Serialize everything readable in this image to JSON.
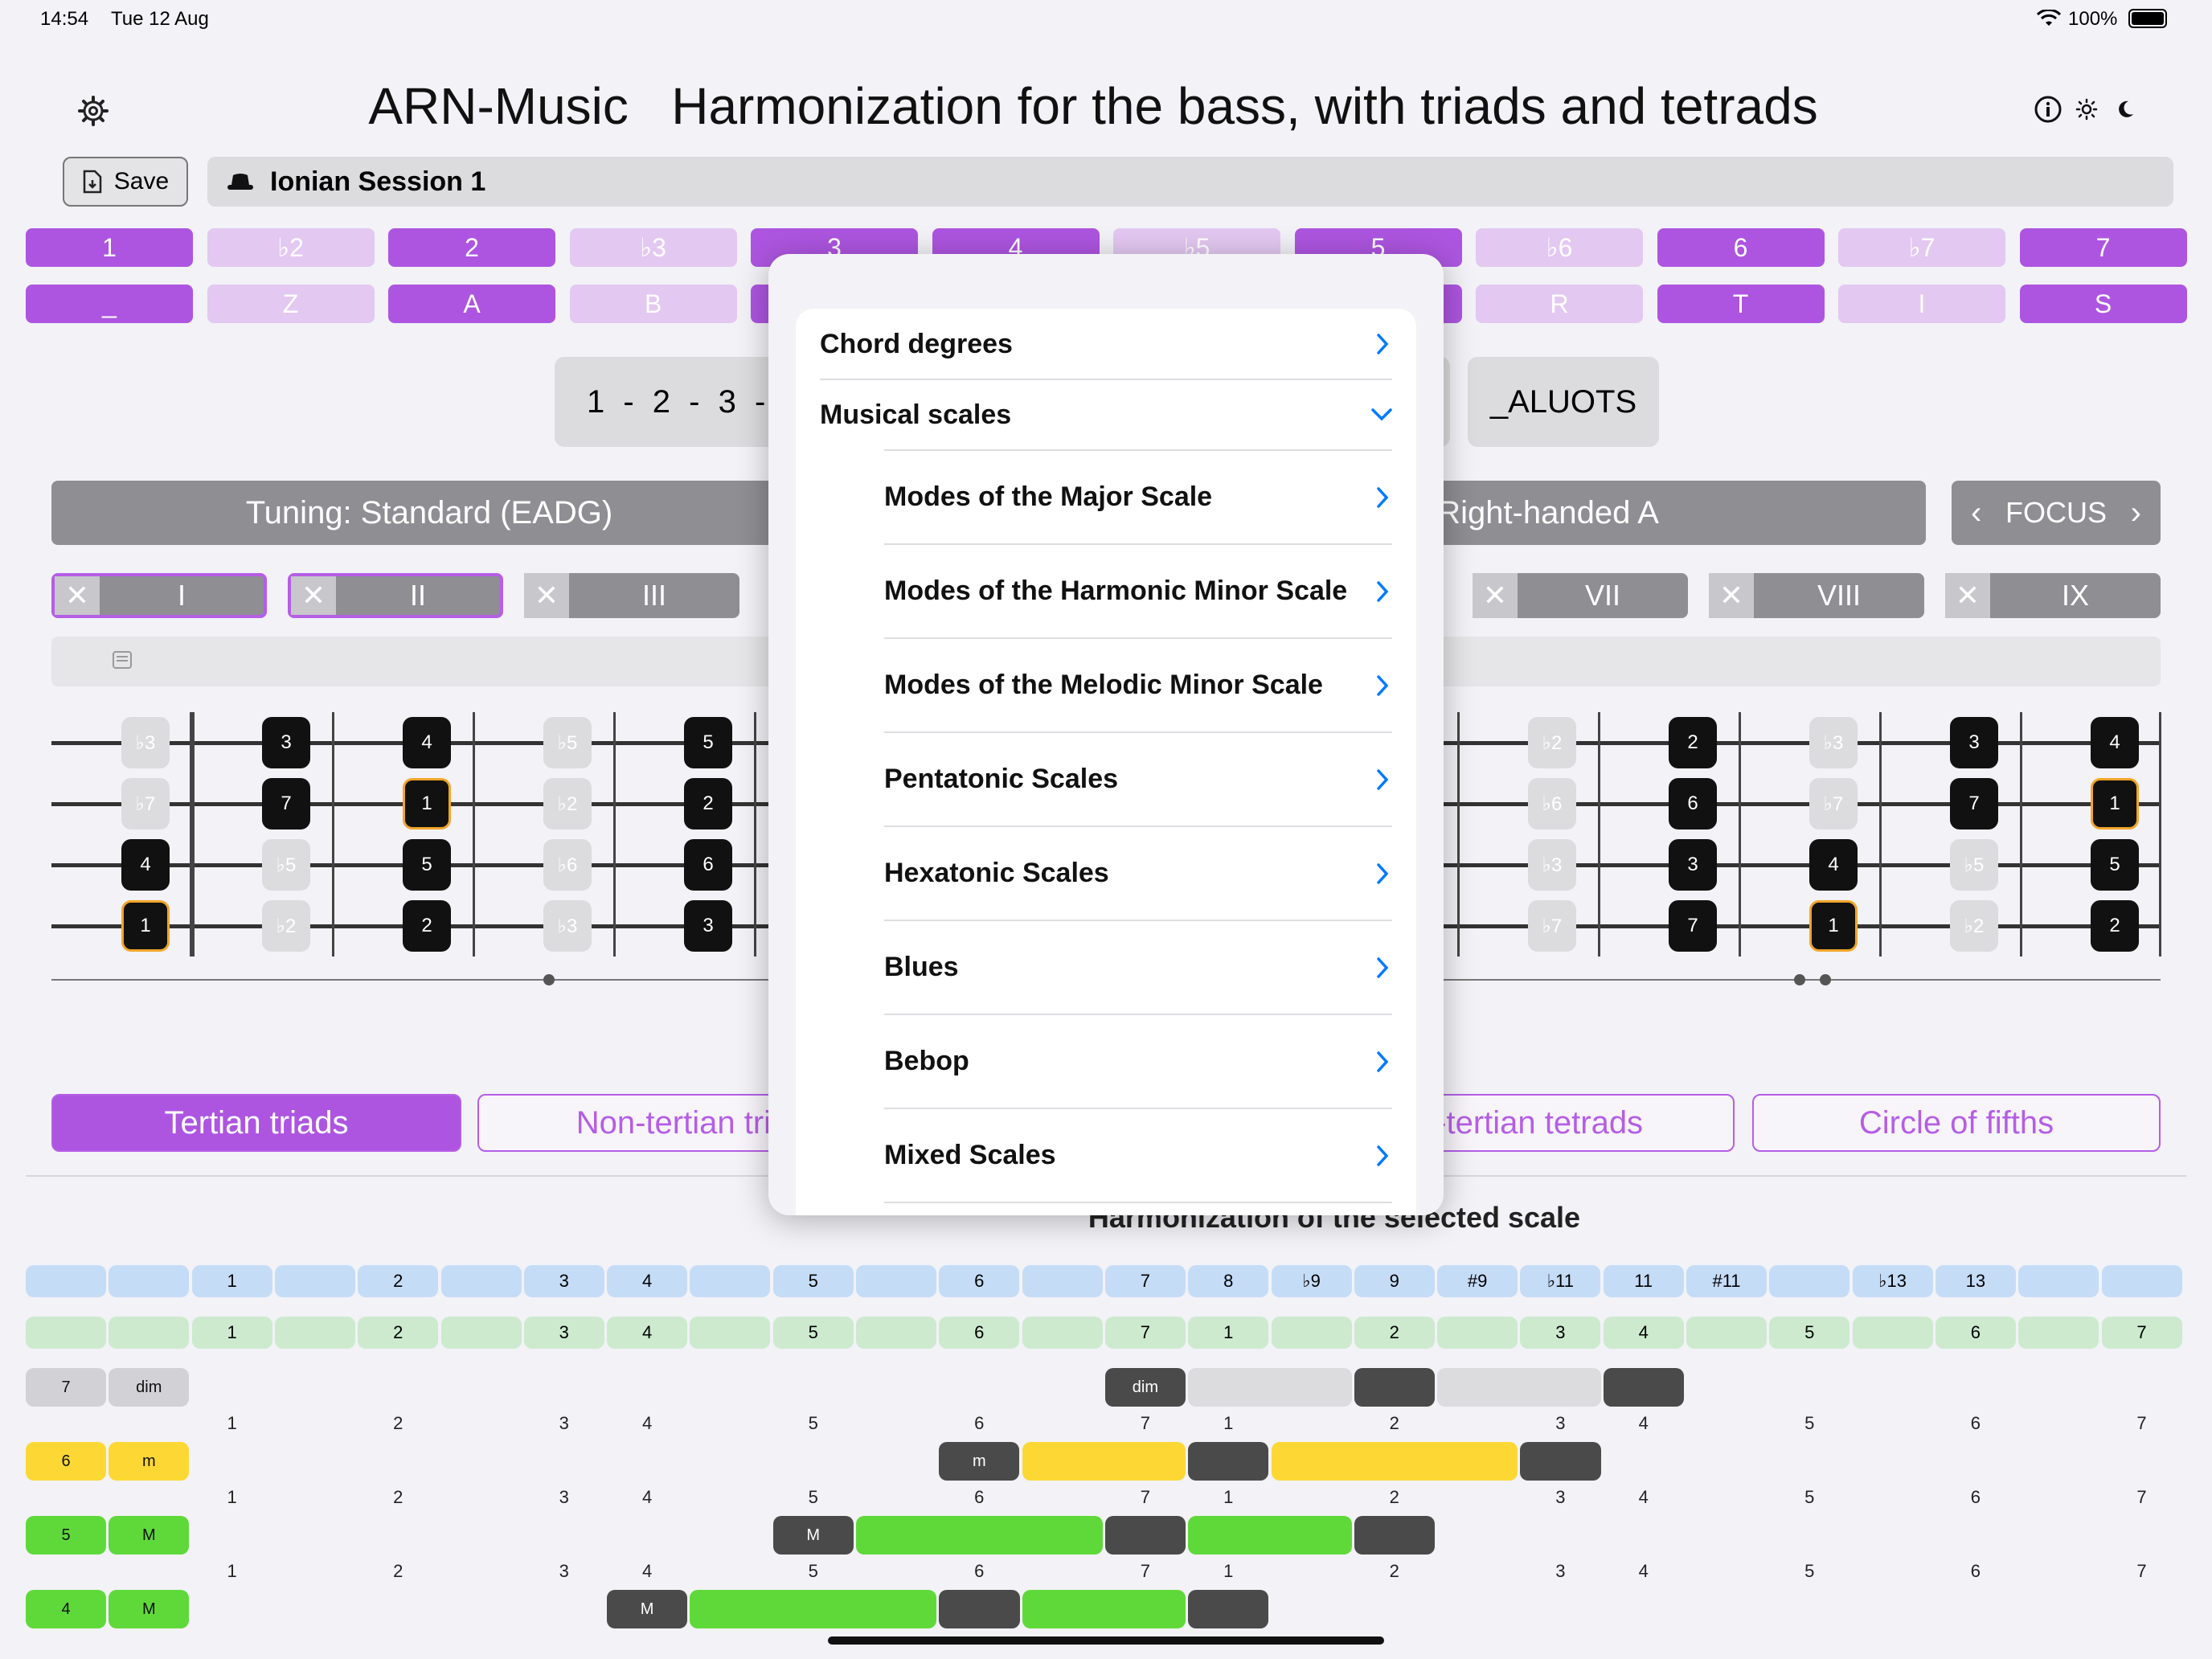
{
  "status": {
    "time": "14:54",
    "date": "Tue 12 Aug",
    "battery": "100%"
  },
  "header": {
    "title": "ARN-Music   Harmonization for the bass, with triads and tetrads"
  },
  "toolbar": {
    "save_label": "Save",
    "session_name": "Ionian Session 1"
  },
  "degrees_top": [
    "1",
    "♭2",
    "2",
    "♭3",
    "3",
    "4",
    "♭5",
    "5",
    "♭6",
    "6",
    "♭7",
    "7"
  ],
  "degrees_bottom": [
    "_",
    "Z",
    "A",
    "B",
    "",
    "",
    "",
    "",
    "R",
    "T",
    "I",
    "S"
  ],
  "degree_state": [
    true,
    false,
    true,
    false,
    true,
    true,
    false,
    true,
    false,
    true,
    false,
    true
  ],
  "sequence": {
    "text": "1 - 2 - 3 -",
    "letters": "_ALUOTS"
  },
  "tuning": {
    "label": "Tuning: Standard (EADG)",
    "hand": ": Right-handed A",
    "focus": "FOCUS"
  },
  "positions": [
    {
      "label": "I",
      "selected": true
    },
    {
      "label": "II",
      "selected": true
    },
    {
      "label": "III",
      "selected": false
    },
    {
      "label": "VII",
      "selected": false
    },
    {
      "label": "VIII",
      "selected": false
    },
    {
      "label": "IX",
      "selected": false
    }
  ],
  "fretboard": {
    "left": [
      {
        "col": 0,
        "row": 0,
        "t": "♭3",
        "k": "g"
      },
      {
        "col": 0,
        "row": 1,
        "t": "♭7",
        "k": "g"
      },
      {
        "col": 0,
        "row": 2,
        "t": "4",
        "k": "b"
      },
      {
        "col": 0,
        "row": 3,
        "t": "1",
        "k": "r"
      },
      {
        "col": 1,
        "row": 0,
        "t": "3",
        "k": "b"
      },
      {
        "col": 1,
        "row": 1,
        "t": "7",
        "k": "b"
      },
      {
        "col": 1,
        "row": 2,
        "t": "♭5",
        "k": "g"
      },
      {
        "col": 1,
        "row": 3,
        "t": "♭2",
        "k": "g"
      },
      {
        "col": 2,
        "row": 0,
        "t": "4",
        "k": "b"
      },
      {
        "col": 2,
        "row": 1,
        "t": "1",
        "k": "r"
      },
      {
        "col": 2,
        "row": 2,
        "t": "5",
        "k": "b"
      },
      {
        "col": 2,
        "row": 3,
        "t": "2",
        "k": "b"
      },
      {
        "col": 3,
        "row": 0,
        "t": "♭5",
        "k": "g"
      },
      {
        "col": 3,
        "row": 1,
        "t": "♭2",
        "k": "g"
      },
      {
        "col": 3,
        "row": 2,
        "t": "♭6",
        "k": "g"
      },
      {
        "col": 3,
        "row": 3,
        "t": "♭3",
        "k": "g"
      },
      {
        "col": 4,
        "row": 0,
        "t": "5",
        "k": "b"
      },
      {
        "col": 4,
        "row": 1,
        "t": "2",
        "k": "b"
      },
      {
        "col": 4,
        "row": 2,
        "t": "6",
        "k": "b"
      },
      {
        "col": 4,
        "row": 3,
        "t": "3",
        "k": "b"
      }
    ],
    "right": [
      {
        "col": 0,
        "row": 0,
        "t": "♭2",
        "k": "g"
      },
      {
        "col": 0,
        "row": 1,
        "t": "♭6",
        "k": "g"
      },
      {
        "col": 0,
        "row": 2,
        "t": "♭3",
        "k": "g"
      },
      {
        "col": 0,
        "row": 3,
        "t": "♭7",
        "k": "g"
      },
      {
        "col": 1,
        "row": 0,
        "t": "2",
        "k": "b"
      },
      {
        "col": 1,
        "row": 1,
        "t": "6",
        "k": "b"
      },
      {
        "col": 1,
        "row": 2,
        "t": "3",
        "k": "b"
      },
      {
        "col": 1,
        "row": 3,
        "t": "7",
        "k": "b"
      },
      {
        "col": 2,
        "row": 0,
        "t": "♭3",
        "k": "g"
      },
      {
        "col": 2,
        "row": 1,
        "t": "♭7",
        "k": "g"
      },
      {
        "col": 2,
        "row": 2,
        "t": "4",
        "k": "b"
      },
      {
        "col": 2,
        "row": 3,
        "t": "1",
        "k": "r"
      },
      {
        "col": 3,
        "row": 0,
        "t": "3",
        "k": "b"
      },
      {
        "col": 3,
        "row": 1,
        "t": "7",
        "k": "b"
      },
      {
        "col": 3,
        "row": 2,
        "t": "♭5",
        "k": "g"
      },
      {
        "col": 3,
        "row": 3,
        "t": "♭2",
        "k": "g"
      },
      {
        "col": 4,
        "row": 0,
        "t": "4",
        "k": "b"
      },
      {
        "col": 4,
        "row": 1,
        "t": "1",
        "k": "r"
      },
      {
        "col": 4,
        "row": 2,
        "t": "5",
        "k": "b"
      },
      {
        "col": 4,
        "row": 3,
        "t": "2",
        "k": "b"
      }
    ]
  },
  "tabs": [
    {
      "label": "Tertian triads",
      "selected": true
    },
    {
      "label": "Non-tertian tria",
      "selected": false
    },
    {
      "label": "n-tertian tetrads",
      "selected": false
    },
    {
      "label": "Circle of fifths",
      "selected": false
    }
  ],
  "harmonization": {
    "title": "Harmonization of the selected scale",
    "intervals": [
      "",
      "",
      "1",
      "",
      "2",
      "",
      "3",
      "4",
      "",
      "5",
      "",
      "6",
      "",
      "7",
      "8",
      "♭9",
      "9",
      "#9",
      "♭11",
      "11",
      "#11",
      "",
      "♭13",
      "13",
      "",
      ""
    ],
    "degrees": [
      "",
      "",
      "1",
      "",
      "2",
      "",
      "3",
      "4",
      "",
      "5",
      "",
      "6",
      "",
      "7",
      "1",
      "",
      "2",
      "",
      "3",
      "4",
      "",
      "5",
      "",
      "6",
      "",
      "7"
    ],
    "numbers": [
      "",
      "",
      "1",
      "",
      "2",
      "",
      "3",
      "4",
      "",
      "5",
      "",
      "6",
      "",
      "7",
      "1",
      "",
      "2",
      "",
      "3",
      "4",
      "",
      "5",
      "",
      "6",
      "",
      "7"
    ],
    "rows": [
      {
        "degree": "7",
        "quality": "dim",
        "color": "#d1d1d6",
        "start": 13,
        "label": "dim",
        "segs": [
          {
            "c": "#dcdcde",
            "w": 2
          },
          {
            "c": "#4a4a4a",
            "w": 1
          },
          {
            "c": "#dcdcde",
            "w": 2
          },
          {
            "c": "#4a4a4a",
            "w": 1
          }
        ]
      },
      {
        "degree": "6",
        "quality": "m",
        "color": "#fdd835",
        "start": 11,
        "label": "m",
        "segs": [
          {
            "c": "#fdd835",
            "w": 2
          },
          {
            "c": "#4a4a4a",
            "w": 1
          },
          {
            "c": "#fdd835",
            "w": 3
          },
          {
            "c": "#4a4a4a",
            "w": 1
          }
        ]
      },
      {
        "degree": "5",
        "quality": "M",
        "color": "#5fd93a",
        "start": 9,
        "label": "M",
        "segs": [
          {
            "c": "#5fd93a",
            "w": 3
          },
          {
            "c": "#4a4a4a",
            "w": 1
          },
          {
            "c": "#5fd93a",
            "w": 2
          },
          {
            "c": "#4a4a4a",
            "w": 1
          }
        ]
      },
      {
        "degree": "4",
        "quality": "M",
        "color": "#5fd93a",
        "start": 7,
        "label": "M",
        "segs": [
          {
            "c": "#5fd93a",
            "w": 3
          },
          {
            "c": "#4a4a4a",
            "w": 1
          },
          {
            "c": "#5fd93a",
            "w": 2
          },
          {
            "c": "#4a4a4a",
            "w": 1
          }
        ]
      }
    ]
  },
  "popover": {
    "items": [
      {
        "label": "Chord degrees",
        "level": 0,
        "chev": "right"
      },
      {
        "label": "Musical scales",
        "level": 0,
        "chev": "down"
      },
      {
        "label": "Modes of the Major Scale",
        "level": 1,
        "chev": "right"
      },
      {
        "label": "Modes of the Harmonic Minor Scale",
        "level": 1,
        "chev": "right"
      },
      {
        "label": "Modes of the Melodic Minor Scale",
        "level": 1,
        "chev": "right"
      },
      {
        "label": "Pentatonic Scales",
        "level": 1,
        "chev": "right"
      },
      {
        "label": "Hexatonic Scales",
        "level": 1,
        "chev": "right"
      },
      {
        "label": "Blues",
        "level": 1,
        "chev": "right"
      },
      {
        "label": "Bebop",
        "level": 1,
        "chev": "right"
      },
      {
        "label": "Mixed Scales",
        "level": 1,
        "chev": "right"
      }
    ]
  },
  "colors": {
    "accent": "#ad55e0",
    "accent_light": "#e3c8f1",
    "link": "#007aff"
  }
}
